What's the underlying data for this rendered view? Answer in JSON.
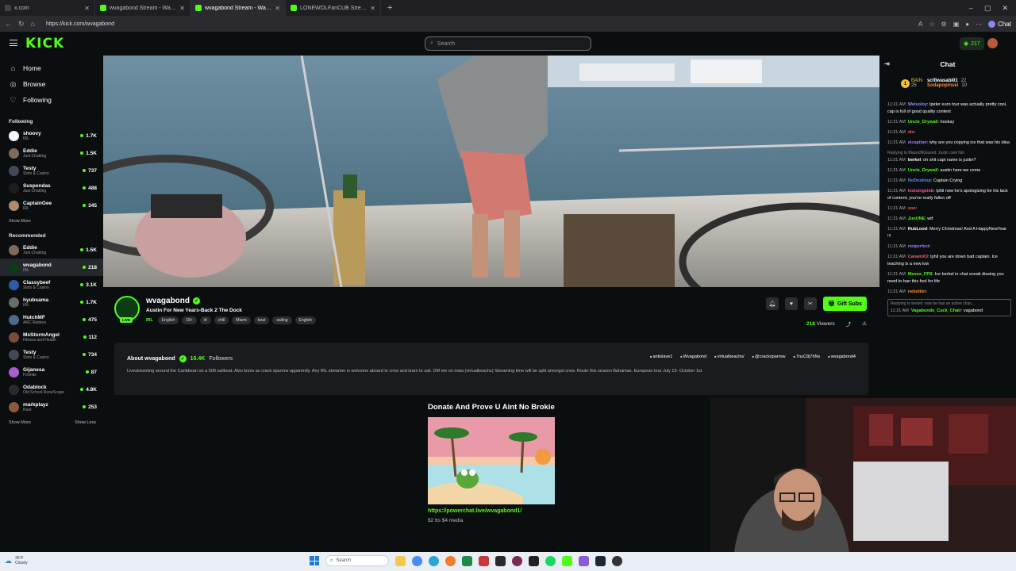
{
  "browser": {
    "tabs": [
      {
        "title": "x.com",
        "active": false
      },
      {
        "title": "wvagabond Stream - Watch L",
        "active": false
      },
      {
        "title": "wvagabond Stream - Watch L",
        "active": true
      },
      {
        "title": "LONEWOLFanCUB Stream - W",
        "active": false
      }
    ],
    "url": "https://kick.com/wvagabond",
    "chat_label": "Chat"
  },
  "topnav": {
    "logo": "KICK",
    "search_placeholder": "Search",
    "points": "217"
  },
  "sidebar": {
    "nav": [
      {
        "label": "Home",
        "icon": "home-icon"
      },
      {
        "label": "Browse",
        "icon": "compass-icon"
      },
      {
        "label": "Following",
        "icon": "heart-icon"
      }
    ],
    "following_title": "Following",
    "following": [
      {
        "name": "shoovy",
        "category": "IRL",
        "viewers": "1.7K",
        "color": "#f5f5f5"
      },
      {
        "name": "Eddie",
        "category": "Just Chatting",
        "viewers": "1.5K",
        "color": "#7d6a5a"
      },
      {
        "name": "Testy",
        "category": "Slots & Casino",
        "viewers": "737",
        "color": "#444a55"
      },
      {
        "name": "Suspendas",
        "category": "Just Chatting",
        "viewers": "488",
        "color": "#1e1e1e"
      },
      {
        "name": "CaptainGee",
        "category": "IRL",
        "viewers": "345",
        "color": "#b08a6a"
      }
    ],
    "show_more": "Show More",
    "recommended_title": "Recommended",
    "recommended": [
      {
        "name": "Eddie",
        "category": "Just Chatting",
        "viewers": "1.5K",
        "color": "#7d6a5a",
        "active": false
      },
      {
        "name": "wvagabond",
        "category": "IRL",
        "viewers": "218",
        "color": "#0e3a14",
        "active": true
      },
      {
        "name": "Classybeef",
        "category": "Slots & Casino",
        "viewers": "3.1K",
        "color": "#2f5aa8",
        "active": false
      },
      {
        "name": "hyubsama",
        "category": "IRL",
        "viewers": "1.7K",
        "color": "#6b6b6b",
        "active": false
      },
      {
        "name": "HutchMF",
        "category": "ARC Raiders",
        "viewers": "475",
        "color": "#4a6b8a",
        "active": false
      },
      {
        "name": "MsStormAngel",
        "category": "Fitness and Health",
        "viewers": "112",
        "color": "#7a4a3a",
        "active": false
      },
      {
        "name": "Testy",
        "category": "Slots & Casino",
        "viewers": "734",
        "color": "#444a55",
        "active": false
      },
      {
        "name": "Gijanesa",
        "category": "Fortnite",
        "viewers": "87",
        "color": "#a55fd0",
        "active": false
      },
      {
        "name": "Odablock",
        "category": "Old School RuneScape",
        "viewers": "4.8K",
        "color": "#2a2a2a",
        "active": false
      },
      {
        "name": "markplayz",
        "category": "Rust",
        "viewers": "253",
        "color": "#8a5a3a",
        "active": false
      }
    ],
    "show_less": "Show Less"
  },
  "stream": {
    "channel": "wvagabond",
    "live_label": "LIVE",
    "title": "Austin For New Years-Back 2 The Dock",
    "category": "IRL",
    "tags": [
      "English",
      "18+",
      "irl",
      "chill",
      "Miami",
      "boat",
      "sailing",
      "English"
    ],
    "gift_label": "Gift Subs",
    "viewers": "218",
    "viewers_label": "Viewers"
  },
  "about": {
    "title": "About wvagabond",
    "followers": "16.4K",
    "followers_label": "Followers",
    "socials": [
      "antislave1",
      "Wvagabond",
      "virtualbeachs/",
      "@cracksparrow",
      "7nuC8j7hNs",
      "wvagabond4"
    ],
    "bio": "Livestreaming around the Caribbean on a 50ft sailboat. Also know as crack sparrow apparently. Any IRL streamer is welcome aboard to crew and learn to sail. DM me on insta (virtualbeachs) Streaming time will be split amongst crew. Route this season Bahamas. European tour July 15- October 1st"
  },
  "panel": {
    "title": "Donate And Prove U Aint No Brokie",
    "link": "https://powerchat.live/wvagabond1/",
    "sub": "$2 tts $4 media"
  },
  "chat": {
    "title": "Chat",
    "leaderboard": [
      {
        "rank": "1",
        "label": "BAIN",
        "name": "scifiwasabi01",
        "count": "22"
      },
      {
        "rank": "",
        "label": "25",
        "name": "Sodapopinski",
        "count": "10"
      }
    ],
    "messages": [
      {
        "time": "11:21 AM",
        "user": "Welsoloy",
        "color": "#8d8dff",
        "text": ": Ipeter euro tour was actually pretty cool, cap is full of good quality content",
        "reply": ""
      },
      {
        "time": "11:21 AM",
        "user": "Uncle_Drywall",
        "color": "#53fc18",
        "text": ": hookay",
        "reply": ""
      },
      {
        "time": "11:21 AM",
        "user": "xlo",
        "color": "#ff5a5a",
        "text": ":",
        "reply": ""
      },
      {
        "time": "11:21 AM",
        "user": "elcapitan",
        "color": "#a07bff",
        "text": ": why are you copying ice that was his idea",
        "reply": ""
      },
      {
        "time": "11:21 AM",
        "user": "berkel",
        "color": "#ffffff",
        "text": ": oh shit capt name is justin?",
        "reply": "Replying to BlazedNGlazed: Justin cant fish"
      },
      {
        "time": "11:21 AM",
        "user": "Uncle_Drywall",
        "color": "#53fc18",
        "text": ": austin here we come",
        "reply": ""
      },
      {
        "time": "11:21 AM",
        "user": "NoDesktop",
        "color": "#5a8dff",
        "text": ": Captain Crying",
        "reply": ""
      },
      {
        "time": "11:21 AM",
        "user": "lostsingslob",
        "color": "#ff5a9a",
        "text": ": Iphil now he's apologizing for his lack of content, you've really fallen off",
        "reply": ""
      },
      {
        "time": "11:21 AM",
        "user": "xoo",
        "color": "#ff5a5a",
        "text": ":",
        "reply": ""
      },
      {
        "time": "11:21 AM",
        "user": "JunUNE",
        "color": "#53fc18",
        "text": ": wtf",
        "reply": ""
      },
      {
        "time": "11:21 AM",
        "user": "RubLood",
        "color": "#ffffff",
        "text": ": Merry Christmas! And A HappyNewYear !!!",
        "reply": ""
      },
      {
        "time": "11:21 AM",
        "user": "notperfect",
        "color": "#a07bff",
        "text": ":",
        "reply": ""
      },
      {
        "time": "11:21 AM",
        "user": "CanamX3",
        "color": "#ff5a5a",
        "text": ": Iphil you are down bad captain. Ice teaching is a new low",
        "reply": ""
      },
      {
        "time": "11:21 AM",
        "user": "Moses_FPS",
        "color": "#53fc18",
        "text": ": Ice berkel in chat sneak dissing you need to ban this fool for life",
        "reply": ""
      },
      {
        "time": "11:21 AM",
        "user": "nebolkin",
        "color": "#ff8a3a",
        "text": ":",
        "reply": ""
      },
      {
        "time": "11:21 AM",
        "user": "Vagabonds_Cuck_Chair",
        "color": "#53fc18",
        "text": ": vagabond",
        "reply": "Replying to berkel: now he has an active chan..."
      }
    ]
  },
  "taskbar": {
    "temp": "36°F",
    "condition": "Cloudy",
    "search": "Search"
  }
}
